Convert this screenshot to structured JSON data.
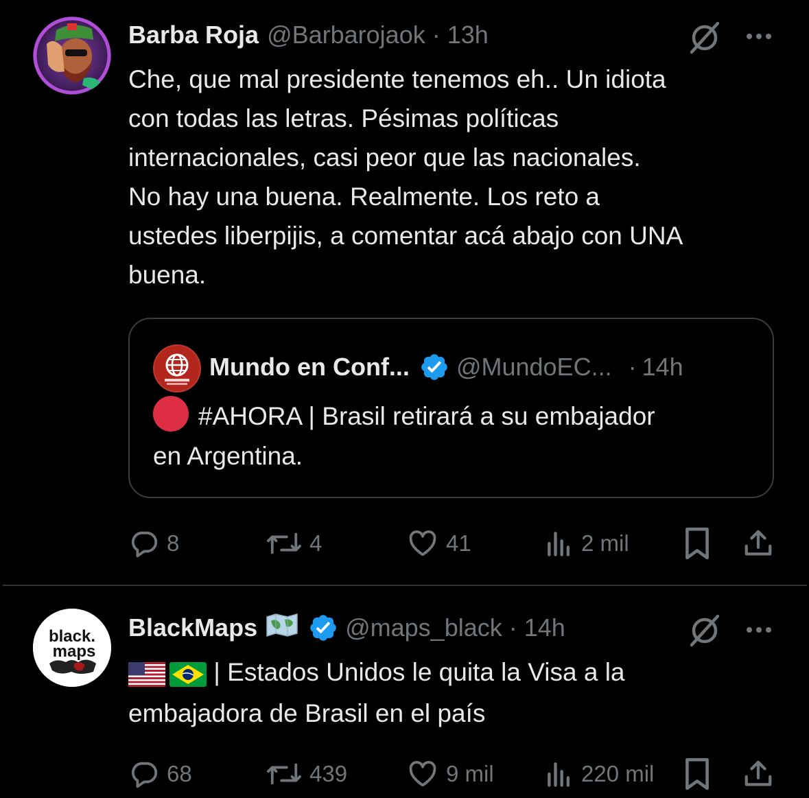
{
  "tweets": [
    {
      "author": "Barba Roja",
      "handle": "@Barbarojaok",
      "sep": "·",
      "time": "13h",
      "text": "Che, que mal presidente tenemos eh.. Un idiota\ncon todas las letras. Pésimas políticas\ninternacionales, casi peor que las nacionales.\nNo hay una buena. Realmente. Los reto a\nustedes liberpijis, a comentar acá abajo con UNA\nbuena.",
      "quote": {
        "author": "Mundo en Conf...",
        "handle": "@MundoEC...",
        "sep": "·",
        "time": "14h",
        "text": "#AHORA | Brasil retirará a su embajador\nen Argentina."
      },
      "stats": {
        "replies": "8",
        "retweets": "4",
        "likes": "41",
        "views": "2 mil"
      }
    },
    {
      "author": "BlackMaps",
      "avatar_text": [
        "black.",
        "maps"
      ],
      "handle": "@maps_black",
      "sep": "·",
      "time": "14h",
      "text_suffix": " | Estados Unidos le quita la Visa a la",
      "text_line2": "embajadora de Brasil en el país",
      "stats": {
        "replies": "68",
        "retweets": "439",
        "likes": "9 mil",
        "views": "220 mil"
      }
    }
  ],
  "icons": [
    "grok-icon",
    "more-icon",
    "reply-icon",
    "retweet-icon",
    "like-icon",
    "views-icon",
    "bookmark-icon",
    "share-icon",
    "verified-icon",
    "map-emoji",
    "us-flag",
    "brazil-flag"
  ],
  "colors": {
    "background": "#000000",
    "text": "#e7e9ea",
    "muted": "#71767b",
    "verified": "#1d9bf0",
    "red_circle": "#dd2e44",
    "border": "#2f3336"
  }
}
